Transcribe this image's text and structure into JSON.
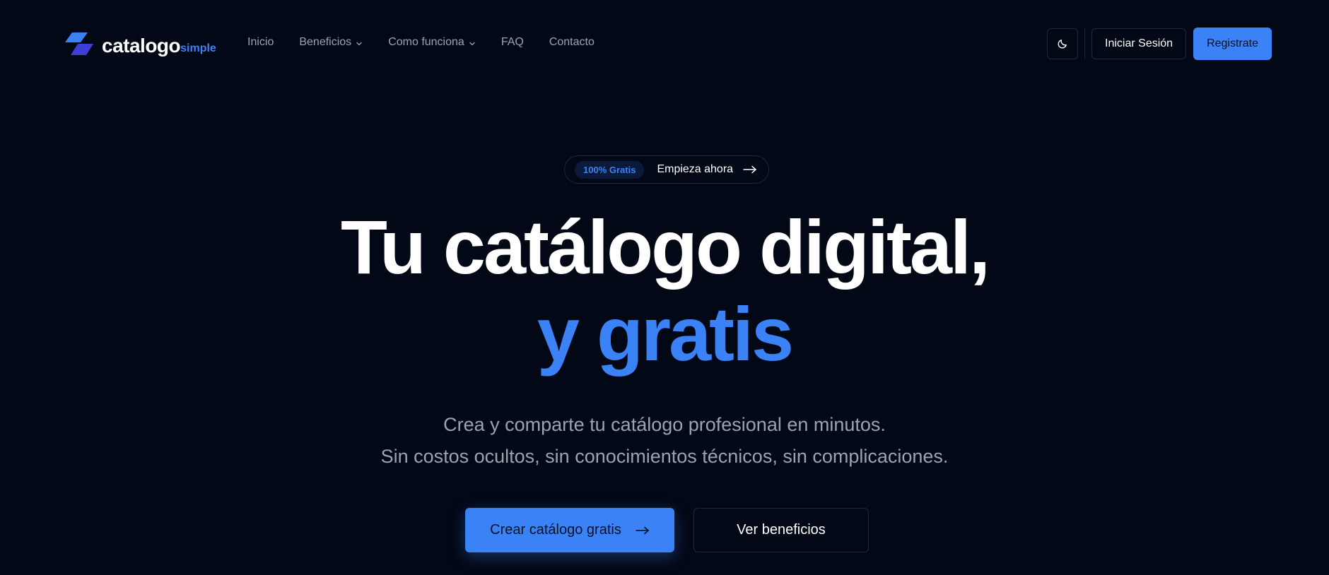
{
  "brand": {
    "name": "catalogo",
    "suffix": "simple",
    "accent_color": "#3b82f6"
  },
  "nav": {
    "links": [
      {
        "label": "Inicio",
        "has_dropdown": false
      },
      {
        "label": "Beneficios",
        "has_dropdown": true
      },
      {
        "label": "Como funciona",
        "has_dropdown": true
      },
      {
        "label": "FAQ",
        "has_dropdown": false
      },
      {
        "label": "Contacto",
        "has_dropdown": false
      }
    ],
    "theme_toggle_icon": "moon-icon",
    "login_label": "Iniciar Sesión",
    "register_label": "Registrate"
  },
  "hero": {
    "badge": "100% Gratis",
    "badge_cta": "Empieza ahora",
    "headline_line1": "Tu catálogo digital,",
    "headline_line2": "y gratis",
    "subtitle_line1": "Crea y comparte tu catálogo profesional en minutos.",
    "subtitle_line2": "Sin costos ocultos, sin conocimientos técnicos, sin complicaciones.",
    "primary_cta": "Crear catálogo gratis",
    "secondary_cta": "Ver beneficios"
  },
  "colors": {
    "background": "#030816",
    "primary": "#3b82f6",
    "muted_text": "#9ca3af",
    "border": "#1f2937"
  }
}
